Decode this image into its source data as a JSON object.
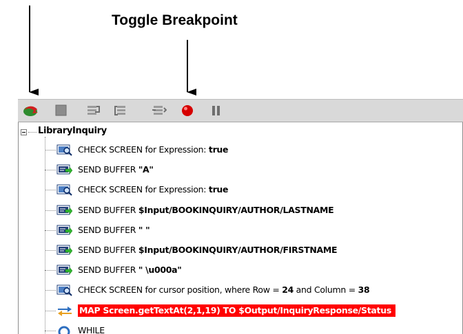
{
  "callout": {
    "label": "Toggle Breakpoint"
  },
  "toolbar": {
    "buttons": [
      {
        "name": "run-icon",
        "color": "#cc3333"
      },
      {
        "name": "stop-icon",
        "color": "#8c8c8c"
      },
      {
        "name": "step-into-icon",
        "color": "#8c8c8c"
      },
      {
        "name": "step-over-icon",
        "color": "#8c8c8c"
      },
      {
        "name": "step-out-icon",
        "color": "#8c8c8c"
      },
      {
        "name": "toggle-breakpoint-icon",
        "color": "#dd0000"
      },
      {
        "name": "pause-icon",
        "color": "#6e6e6e"
      }
    ]
  },
  "tree": {
    "root": "LibraryInquiry",
    "items": [
      {
        "icon": "check-screen-icon",
        "prefix": "CHECK SCREEN for Expression: ",
        "value": "true"
      },
      {
        "icon": "send-buffer-icon",
        "prefix": "SEND BUFFER ",
        "value": "\"A\""
      },
      {
        "icon": "check-screen-icon",
        "prefix": "CHECK SCREEN for Expression: ",
        "value": "true"
      },
      {
        "icon": "send-buffer-icon",
        "prefix": "SEND BUFFER ",
        "value": "$Input/BOOKINQUIRY/AUTHOR/LASTNAME"
      },
      {
        "icon": "send-buffer-icon",
        "prefix": "SEND BUFFER ",
        "value": "\" \""
      },
      {
        "icon": "send-buffer-icon",
        "prefix": "SEND BUFFER ",
        "value": "$Input/BOOKINQUIRY/AUTHOR/FIRSTNAME"
      },
      {
        "icon": "send-buffer-icon",
        "prefix": "SEND BUFFER ",
        "value": "\" \\u000a\""
      },
      {
        "icon": "check-screen-icon",
        "prefix": "CHECK SCREEN for cursor position, where Row = ",
        "value": "24",
        "mid": " and Column = ",
        "value2": "38"
      },
      {
        "icon": "map-icon",
        "selected": true,
        "text": "MAP Screen.getTextAt(2,1,19) TO $Output/InquiryResponse/Status"
      },
      {
        "icon": "while-icon",
        "text": "WHILE"
      }
    ]
  }
}
